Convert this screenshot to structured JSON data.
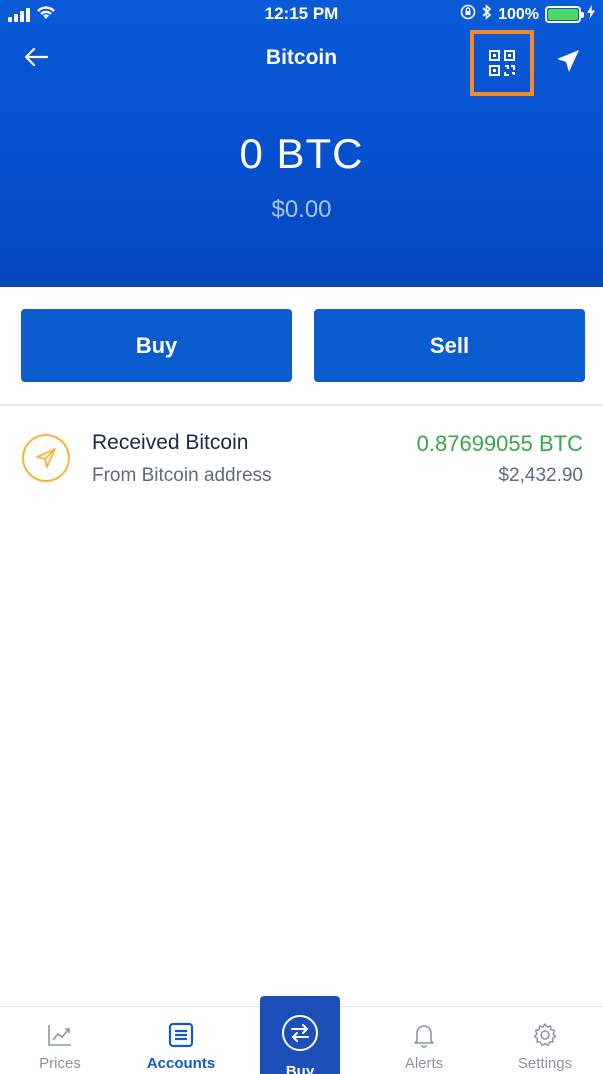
{
  "status_bar": {
    "time": "12:15 PM",
    "battery": "100%"
  },
  "nav": {
    "title": "Bitcoin"
  },
  "balance": {
    "crypto": "0 BTC",
    "fiat": "$0.00"
  },
  "actions": {
    "buy_label": "Buy",
    "sell_label": "Sell"
  },
  "transactions": [
    {
      "title": "Received Bitcoin",
      "subtitle": "From Bitcoin address",
      "amount": "0.87699055 BTC",
      "fiat": "$2,432.90"
    }
  ],
  "tabs": {
    "prices": "Prices",
    "accounts": "Accounts",
    "buy": "Buy",
    "alerts": "Alerts",
    "settings": "Settings"
  },
  "colors": {
    "header_blue": "#0650cf",
    "button_blue": "#0b5ccf",
    "qr_highlight": "#f28c28",
    "received_green": "#3aa64a",
    "received_icon": "#f4b73a"
  }
}
